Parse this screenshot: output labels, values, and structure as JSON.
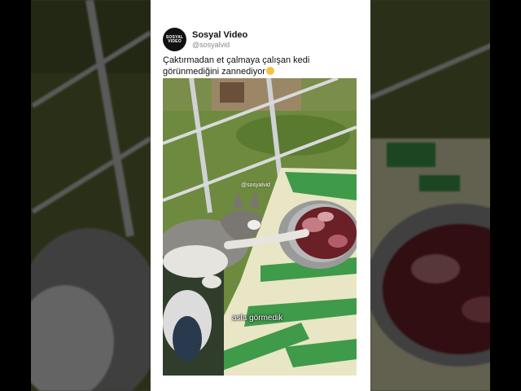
{
  "post": {
    "display_name": "Sosyal Video",
    "handle": "@sosyalvid",
    "avatar_text_line1": "SOSYAL",
    "avatar_text_line2": "VIDEO",
    "caption": "Çaktırmadan et çalmaya çalışan kedi görünmediğini zannediyor",
    "caption_emoji": "smiling-face-emoji"
  },
  "video": {
    "watermark": "@sosyalvid",
    "subtitle": "asla görmedik"
  },
  "colors": {
    "card_background": "#ffffff",
    "page_background": "#000000",
    "mat_green": "#3f9a4a",
    "mat_cream": "#e8e6c4",
    "grass": "#6e8a3e"
  }
}
